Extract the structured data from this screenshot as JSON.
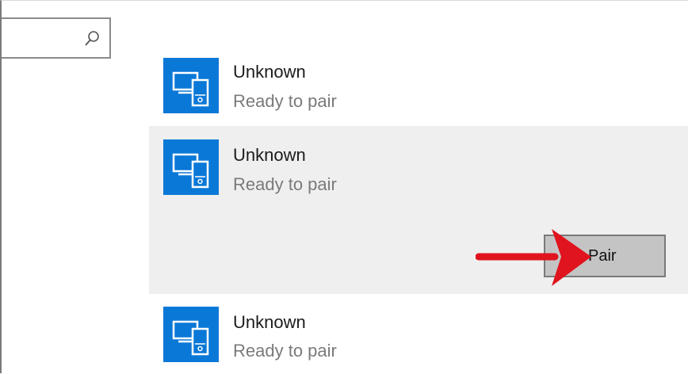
{
  "search": {
    "icon": "search-icon",
    "value": ""
  },
  "devices": [
    {
      "name": "Unknown",
      "status": "Ready to pair",
      "icon": "devices-icon"
    },
    {
      "name": "Unknown",
      "status": "Ready to pair",
      "icon": "devices-icon"
    },
    {
      "name": "Unknown",
      "status": "Ready to pair",
      "icon": "devices-icon"
    }
  ],
  "pair_button": {
    "label": "Pair"
  },
  "annotation": {
    "arrow_icon": "red-arrow-icon",
    "arrow_color": "#e0141e"
  },
  "colors": {
    "tile_blue": "#0a78d7",
    "selected_bg": "#efefef"
  }
}
